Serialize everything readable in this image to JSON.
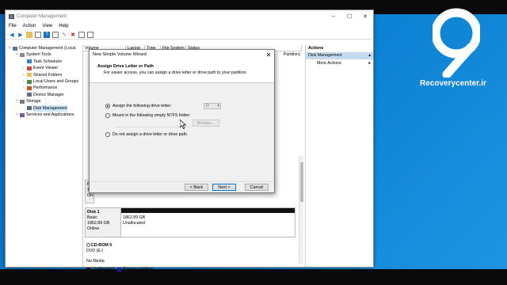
{
  "window": {
    "title": "Computer Management",
    "menu": [
      "File",
      "Action",
      "View",
      "Help"
    ]
  },
  "tree": [
    {
      "label": "Computer Management (Local",
      "indent": 0,
      "icon": "computer-icon"
    },
    {
      "label": "System Tools",
      "indent": 1,
      "icon": "tools-icon"
    },
    {
      "label": "Task Scheduler",
      "indent": 2,
      "icon": "clock-icon"
    },
    {
      "label": "Event Viewer",
      "indent": 2,
      "icon": "log-icon"
    },
    {
      "label": "Shared Folders",
      "indent": 2,
      "icon": "folder-icon"
    },
    {
      "label": "Local Users and Groups",
      "indent": 2,
      "icon": "users-icon"
    },
    {
      "label": "Performance",
      "indent": 2,
      "icon": "chart-icon"
    },
    {
      "label": "Device Manager",
      "indent": 2,
      "icon": "device-icon"
    },
    {
      "label": "Storage",
      "indent": 1,
      "icon": "storage-icon"
    },
    {
      "label": "Disk Management",
      "indent": 2,
      "icon": "disk-icon",
      "selected": true
    },
    {
      "label": "Services and Applications",
      "indent": 1,
      "icon": "services-icon"
    }
  ],
  "volumes": {
    "columns": [
      "Volume",
      "Layout",
      "Type",
      "File System",
      "Status"
    ],
    "row_fragment": "Partition)"
  },
  "disks": {
    "hidden_fragment": [
      "Ba",
      "11",
      "On"
    ],
    "disk1": {
      "name": "Disk 1",
      "type": "Basic",
      "size": "1862.89 GB",
      "status": "Online",
      "partition_size": "1862.89 GB",
      "partition_status": "Unallocated"
    },
    "cdrom": {
      "name": "CD-ROM 0",
      "type": "DVD (E:)",
      "media": "No Media"
    }
  },
  "legend": {
    "unallocated": "Unallocated",
    "primary": "Primary partition"
  },
  "actions": {
    "header": "Actions",
    "section": "Disk Management",
    "more": "More Actions"
  },
  "wizard": {
    "title": "New Simple Volume Wizard",
    "heading": "Assign Drive Letter or Path",
    "subheading": "For easier access, you can assign a drive letter or drive path to your partition.",
    "option_letter": "Assign the following drive letter:",
    "drive_letter": "D",
    "option_folder": "Mount in the following empty NTFS folder:",
    "browse": "Browse...",
    "option_none": "Do not assign a drive letter or drive path",
    "back": "< Back",
    "next": "Next >",
    "cancel": "Cancel"
  },
  "brand": {
    "text": "Recoverycenter.ir"
  },
  "colors": {
    "accent": "#0078d7",
    "selection": "#cce4f7",
    "primary_partition": "#1a1aa0",
    "brand_bg": "#0a7fd3"
  }
}
